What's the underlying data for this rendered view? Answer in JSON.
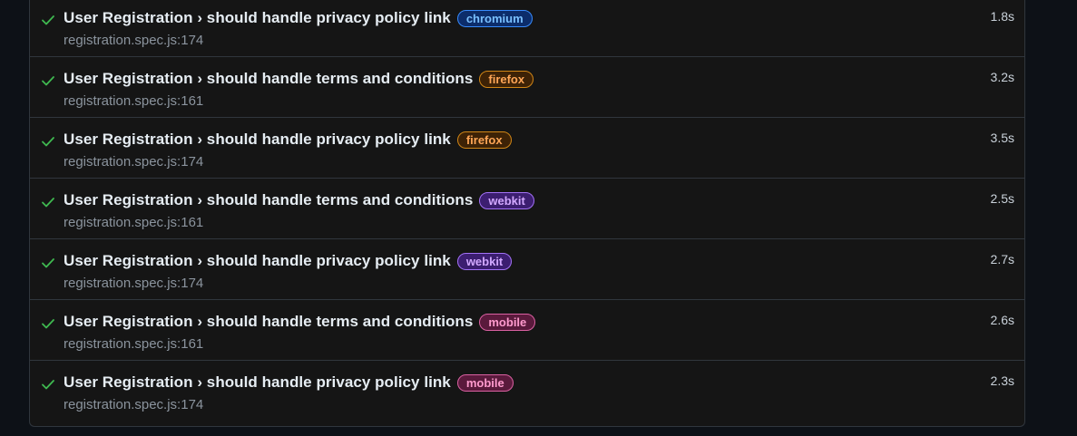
{
  "colors": {
    "background": "#0d1117",
    "panel": "#151515",
    "border": "#30363d",
    "pass": "#3fb950",
    "title": "#e6edf3",
    "muted": "#8b949e"
  },
  "tests": [
    {
      "status_icon": "check-icon",
      "title": "User Registration › should handle privacy policy link",
      "project": "chromium",
      "location": "registration.spec.js:174",
      "duration": "1.8s"
    },
    {
      "status_icon": "check-icon",
      "title": "User Registration › should handle terms and conditions",
      "project": "firefox",
      "location": "registration.spec.js:161",
      "duration": "3.2s"
    },
    {
      "status_icon": "check-icon",
      "title": "User Registration › should handle privacy policy link",
      "project": "firefox",
      "location": "registration.spec.js:174",
      "duration": "3.5s"
    },
    {
      "status_icon": "check-icon",
      "title": "User Registration › should handle terms and conditions",
      "project": "webkit",
      "location": "registration.spec.js:161",
      "duration": "2.5s"
    },
    {
      "status_icon": "check-icon",
      "title": "User Registration › should handle privacy policy link",
      "project": "webkit",
      "location": "registration.spec.js:174",
      "duration": "2.7s"
    },
    {
      "status_icon": "check-icon",
      "title": "User Registration › should handle terms and conditions",
      "project": "mobile",
      "location": "registration.spec.js:161",
      "duration": "2.6s"
    },
    {
      "status_icon": "check-icon",
      "title": "User Registration › should handle privacy policy link",
      "project": "mobile",
      "location": "registration.spec.js:174",
      "duration": "2.3s"
    }
  ]
}
